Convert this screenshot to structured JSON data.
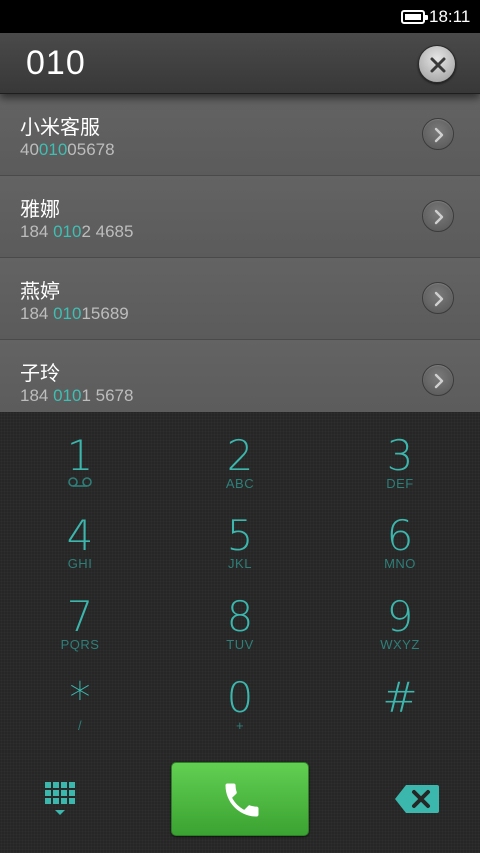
{
  "status_bar": {
    "time": "18:11",
    "battery_icon": "battery-full-icon"
  },
  "number_bar": {
    "dialed_number": "010",
    "clear_icon": "clear-icon"
  },
  "accent_color": "#3ebfb3",
  "contacts": [
    {
      "name": "小米客服",
      "number_pre": "40",
      "number_match": "010",
      "number_post": "05678"
    },
    {
      "name": "雅娜",
      "number_pre": "184 ",
      "number_match": "010",
      "number_post": "2 4685"
    },
    {
      "name": "燕婷",
      "number_pre": "184 ",
      "number_match": "010",
      "number_post": "15689"
    },
    {
      "name": "子玲",
      "number_pre": "184 ",
      "number_match": "010",
      "number_post": "1 5678"
    }
  ],
  "dialpad": {
    "keys": [
      {
        "digit": "1",
        "letters": ""
      },
      {
        "digit": "2",
        "letters": "ABC"
      },
      {
        "digit": "3",
        "letters": "DEF"
      },
      {
        "digit": "4",
        "letters": "GHI"
      },
      {
        "digit": "5",
        "letters": "JKL"
      },
      {
        "digit": "6",
        "letters": "MNO"
      },
      {
        "digit": "7",
        "letters": "PQRS"
      },
      {
        "digit": "8",
        "letters": "TUV"
      },
      {
        "digit": "9",
        "letters": "WXYZ"
      },
      {
        "digit": "*",
        "letters": "/"
      },
      {
        "digit": "0",
        "letters": "+"
      },
      {
        "digit": "#",
        "letters": ""
      }
    ]
  },
  "bottom_bar": {
    "grid_icon": "dialpad-toggle-icon",
    "call_icon": "phone-icon",
    "backspace_icon": "backspace-icon",
    "call_color": "#4cb83f"
  }
}
